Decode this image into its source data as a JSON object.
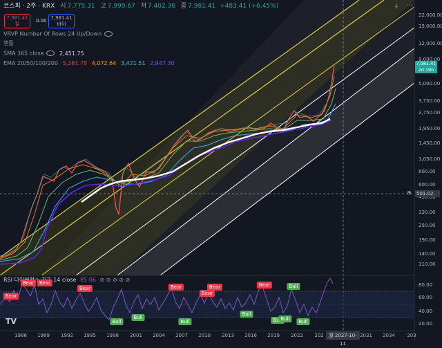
{
  "header": {
    "symbol": "코스피 · 2주 · KRX",
    "open_label": "시",
    "open": "7,775.31",
    "high_label": "고",
    "high": "7,999.67",
    "low_label": "저",
    "low": "7,402.36",
    "close_label": "종",
    "close": "7,981.41",
    "change": "+483.41 (+6.45%)"
  },
  "trade": {
    "sell_price": "7,981.41",
    "sell_label": "팔",
    "spread": "0.00",
    "buy_price": "7,981.41",
    "buy_label": "바이"
  },
  "indicators": {
    "vrvp": "VRVP Number Of Rows 24 Up/Down",
    "bands": "밴들",
    "sma_label": "SMA 365 close",
    "sma_value": "2,451.75",
    "ema_label": "EMA 20/50/100/200",
    "ema_values": [
      "5,261.78",
      "4,072.64",
      "3,421.51",
      "2,947.30"
    ]
  },
  "price_tag": {
    "price": "7,981.41",
    "countdown": "2d 19h"
  },
  "crosshair_price": "501.02",
  "crosshair_date": "월 2027-10-11",
  "y_ticks": [
    "22,000.00",
    "15,000.00",
    "12,000.00",
    "9,000.00",
    "5,000.00",
    "3,750.00",
    "2,750.00",
    "1,950.00",
    "1,450.00",
    "1,050.00",
    "800.00",
    "600.00",
    "450.00",
    "330.00",
    "250.00",
    "190.00",
    "140.00",
    "110.00"
  ],
  "x_ticks": [
    "1986",
    "1989",
    "1992",
    "1995",
    "1998",
    "2001",
    "2004",
    "2007",
    "2010",
    "2013",
    "2016",
    "2019",
    "2022",
    "202",
    "2031",
    "2034",
    "203"
  ],
  "rsi": {
    "title": "RSI 다이버전스 지표 14 close",
    "value": "85.06",
    "ticks": [
      "80.00",
      "60.00",
      "40.00",
      "20.00"
    ],
    "labels": [
      {
        "text": "Bear",
        "type": "bear"
      },
      {
        "text": "Bear",
        "type": "bear"
      },
      {
        "text": "Bear",
        "type": "bear"
      },
      {
        "text": "Bear",
        "type": "bear"
      },
      {
        "text": "Bear",
        "type": "bear"
      },
      {
        "text": "Bear",
        "type": "bear"
      },
      {
        "text": "Bear",
        "type": "bear"
      },
      {
        "text": "Bear",
        "type": "bear"
      },
      {
        "text": "Bull",
        "type": "bull"
      },
      {
        "text": "Bull",
        "type": "bull"
      },
      {
        "text": "Bull",
        "type": "bull"
      },
      {
        "text": "Bull",
        "type": "bull"
      },
      {
        "text": "Bull",
        "type": "bull"
      },
      {
        "text": "Bull",
        "type": "bull"
      },
      {
        "text": "Bull",
        "type": "bull"
      },
      {
        "text": "Bull",
        "type": "bull"
      }
    ]
  },
  "logo": "TV",
  "colors": {
    "background": "#131722",
    "up": "#26a69a",
    "down": "#f23645",
    "rsi_line": "#7e57c2",
    "channel_yellow": "#e3d23a"
  }
}
